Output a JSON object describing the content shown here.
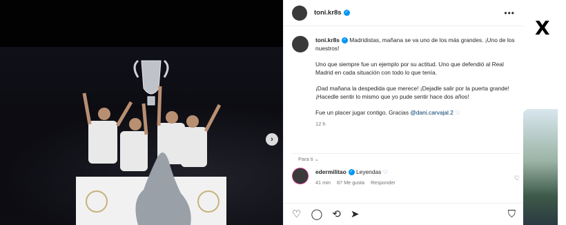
{
  "post": {
    "author": "toni.kr8s",
    "caption": {
      "username": "toni.kr8s",
      "line1": "Madridistas, mañana se va uno de los más grandes. ¡Uno de los nuestros!",
      "line2": "Uno que siempre fue un ejemplo por su actitud. Uno que defendió al Real Madrid en cada situación con todo lo que tenía.",
      "line3": "¡Dad mañana la despedida que merece! ¡Dejadle salir por la puerta grande! ¡Hacedle sentir lo mismo que yo pude sentir hace dos años!",
      "line4_prefix": "Fue un placer jugar contigo. Gracias ",
      "mention": "@dani.carvajal.2",
      "timestamp": "12 h"
    },
    "filter_label": "Para ti",
    "comment": {
      "username": "edermilitao",
      "text": "Leyendas",
      "time": "41 min",
      "likes": "87 Me gusta",
      "reply": "Responder"
    }
  },
  "icons": {
    "like": "heart-icon",
    "comment": "comment-icon",
    "share": "share-icon",
    "send": "send-icon",
    "save": "bookmark-icon",
    "x_logo": "x-logo-icon"
  },
  "colors": {
    "verified": "#0095f6",
    "mention": "#00376b",
    "muted": "#737373"
  }
}
